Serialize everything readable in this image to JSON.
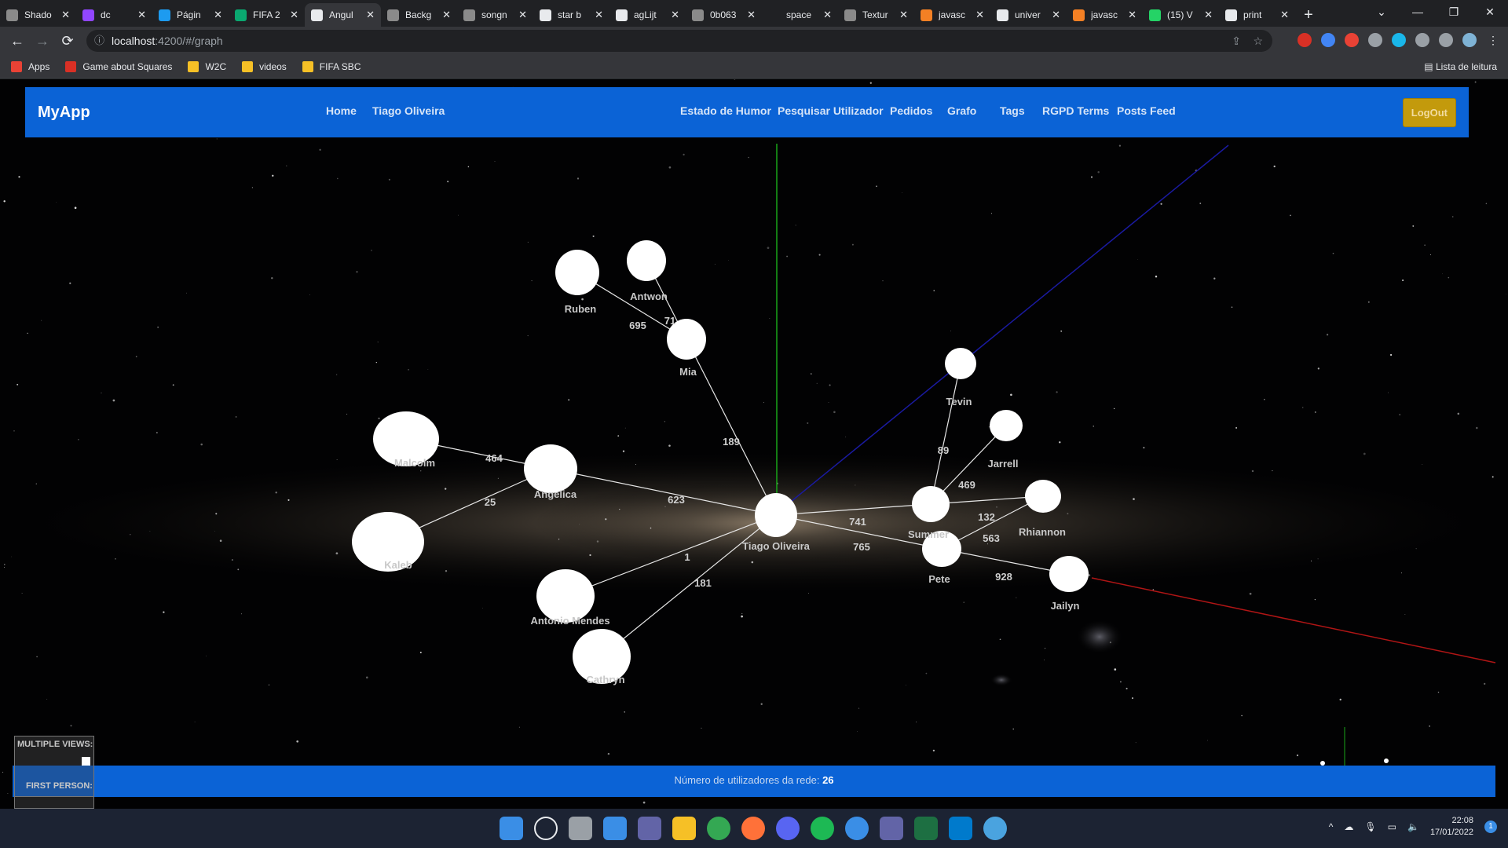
{
  "browser": {
    "tabs": [
      {
        "title": "Shado",
        "fav": "#8a8a8a"
      },
      {
        "title": "dc",
        "fav": "#9146ff"
      },
      {
        "title": "Págin",
        "fav": "#1d9bf0"
      },
      {
        "title": "FIFA 2",
        "fav": "#0aa870"
      },
      {
        "title": "Angul",
        "fav": "#e8eaed"
      },
      {
        "title": "Backg",
        "fav": "#8a8a8a"
      },
      {
        "title": "songn",
        "fav": "#8a8a8a"
      },
      {
        "title": "star b",
        "fav": "#e8eaed"
      },
      {
        "title": "agLijt",
        "fav": "#e8eaed"
      },
      {
        "title": "0b063",
        "fav": "#8a8a8a"
      },
      {
        "title": "space",
        "fav": "#202124"
      },
      {
        "title": "Textur",
        "fav": "#8a8a8a"
      },
      {
        "title": "javasc",
        "fav": "#f48024"
      },
      {
        "title": "univer",
        "fav": "#e8eaed"
      },
      {
        "title": "javasc",
        "fav": "#f48024"
      },
      {
        "title": "(15) V",
        "fav": "#25d366"
      },
      {
        "title": "print",
        "fav": "#e8eaed"
      }
    ],
    "active_tab_index": 4,
    "new_tab_label": "+",
    "url_host": "localhost",
    "url_path": ":4200/#/graph",
    "bookmarks": [
      {
        "label": "Apps",
        "color": "#e94235"
      },
      {
        "label": "Game about Squares",
        "color": "#d93025"
      },
      {
        "label": "W2C",
        "color": "#f6c026"
      },
      {
        "label": "videos",
        "color": "#f6c026"
      },
      {
        "label": "FIFA SBC",
        "color": "#f6c026"
      }
    ],
    "reading_list": "Lista de leitura"
  },
  "app": {
    "brand": "MyApp",
    "nav_left": [
      "Home",
      "Tiago Oliveira"
    ],
    "nav_right": [
      "Estado de Humor",
      "Pesquisar Utilizador",
      "Pedidos",
      "Grafo",
      "Tags",
      "RGPD Terms",
      "Posts Feed"
    ],
    "logout": "LogOut",
    "footer_text": "Número de utilizadores da rede: ",
    "footer_count": "26",
    "multiple_views_label": "MULTIPLE VIEWS:",
    "first_person_label": "FIRST PERSON:"
  },
  "graph": {
    "nodes": [
      {
        "name": "Ruben"
      },
      {
        "name": "Antwon"
      },
      {
        "name": "Mia"
      },
      {
        "name": "Malcolm"
      },
      {
        "name": "Angelica"
      },
      {
        "name": "Kaleb"
      },
      {
        "name": "Tiago Oliveira"
      },
      {
        "name": "Antonio Mendes"
      },
      {
        "name": "Cathryn"
      },
      {
        "name": "Tevin"
      },
      {
        "name": "Jarrell"
      },
      {
        "name": "Summer"
      },
      {
        "name": "Rhiannon"
      },
      {
        "name": "Pete"
      },
      {
        "name": "Jailyn"
      }
    ],
    "edge_weights": [
      "695",
      "71",
      "189",
      "464",
      "25",
      "623",
      "1",
      "181",
      "89",
      "469",
      "741",
      "132",
      "563",
      "765",
      "928"
    ]
  },
  "taskbar": {
    "time": "22:08",
    "date": "17/01/2022",
    "notifications": "1"
  }
}
